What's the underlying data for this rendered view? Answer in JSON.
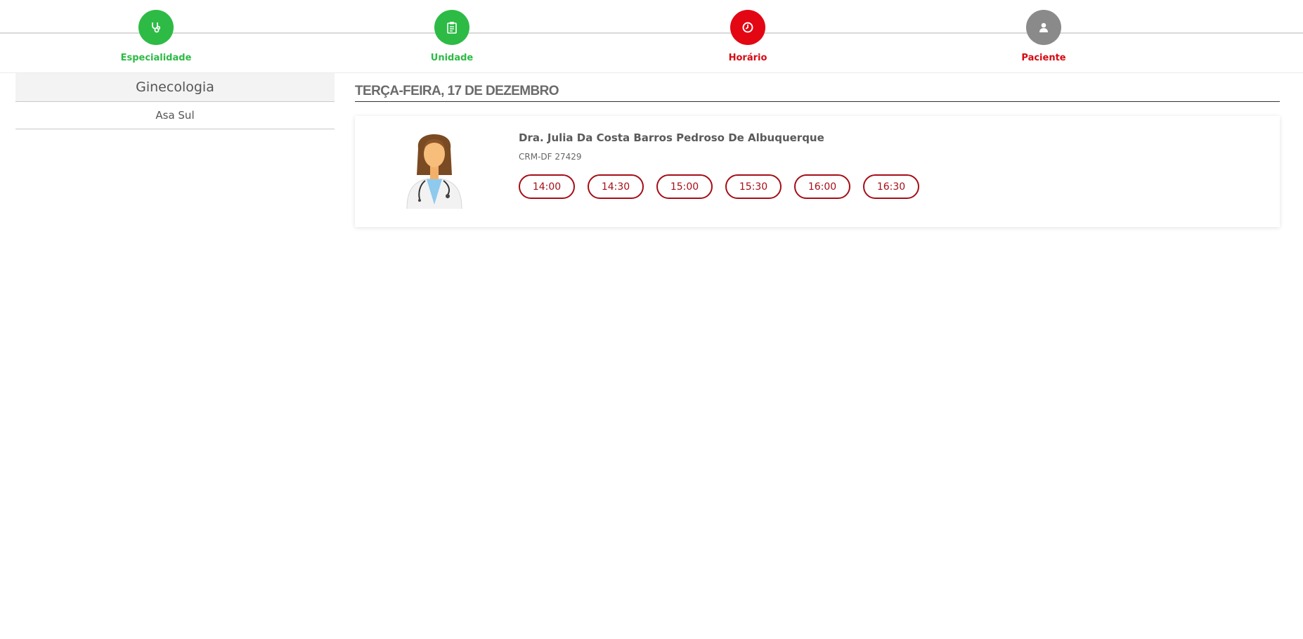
{
  "steps": [
    {
      "label": "Especialidade",
      "icon": "stethoscope-icon",
      "state": "done"
    },
    {
      "label": "Unidade",
      "icon": "clipboard-icon",
      "state": "done"
    },
    {
      "label": "Horário",
      "icon": "clock-icon",
      "state": "current"
    },
    {
      "label": "Paciente",
      "icon": "user-icon",
      "state": "pending"
    }
  ],
  "summary": {
    "specialty": "Ginecologia",
    "unit": "Asa Sul"
  },
  "schedule": {
    "date_heading": "TERÇA-FEIRA, 17 DE DEZEMBRO",
    "doctor": {
      "name": "Dra. Julia Da Costa Barros Pedroso De Albuquerque",
      "crm": "CRM-DF 27429",
      "avatar": "female-doctor-avatar"
    },
    "slots": [
      "14:00",
      "14:30",
      "15:00",
      "15:30",
      "16:00",
      "16:30"
    ]
  },
  "colors": {
    "done": "#2dbb45",
    "current": "#e30613",
    "pending": "#8a8a8a",
    "slot": "#a50e17"
  }
}
